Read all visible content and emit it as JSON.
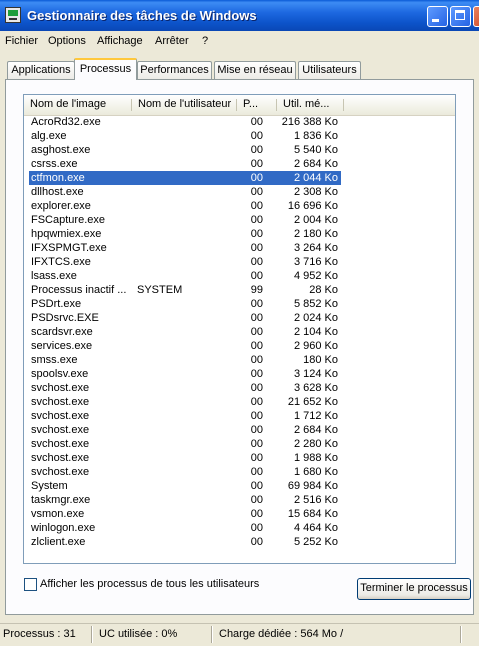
{
  "window": {
    "title": "Gestionnaire des tâches de Windows"
  },
  "menu": [
    "Fichier",
    "Options",
    "Affichage",
    "Arrêter",
    "?"
  ],
  "tabs": [
    {
      "label": "Applications",
      "active": false
    },
    {
      "label": "Processus",
      "active": true
    },
    {
      "label": "Performances",
      "active": false
    },
    {
      "label": "Mise en réseau",
      "active": false
    },
    {
      "label": "Utilisateurs",
      "active": false
    }
  ],
  "table": {
    "columns": [
      "Nom de l'image",
      "Nom de l'utilisateur",
      "P...",
      "Util. mé..."
    ],
    "rows": [
      {
        "name": "AcroRd32.exe",
        "user": "",
        "cpu": "00",
        "mem": "216 388 Ko"
      },
      {
        "name": "alg.exe",
        "user": "",
        "cpu": "00",
        "mem": "1 836 Ko"
      },
      {
        "name": "asghost.exe",
        "user": "",
        "cpu": "00",
        "mem": "5 540 Ko"
      },
      {
        "name": "csrss.exe",
        "user": "",
        "cpu": "00",
        "mem": "2 684 Ko"
      },
      {
        "name": "ctfmon.exe",
        "user": "",
        "cpu": "00",
        "mem": "2 044 Ko",
        "selected": true
      },
      {
        "name": "dllhost.exe",
        "user": "",
        "cpu": "00",
        "mem": "2 308 Ko"
      },
      {
        "name": "explorer.exe",
        "user": "",
        "cpu": "00",
        "mem": "16 696 Ko"
      },
      {
        "name": "FSCapture.exe",
        "user": "",
        "cpu": "00",
        "mem": "2 004 Ko"
      },
      {
        "name": "hpqwmiex.exe",
        "user": "",
        "cpu": "00",
        "mem": "2 180 Ko"
      },
      {
        "name": "IFXSPMGT.exe",
        "user": "",
        "cpu": "00",
        "mem": "3 264 Ko"
      },
      {
        "name": "IFXTCS.exe",
        "user": "",
        "cpu": "00",
        "mem": "3 716 Ko"
      },
      {
        "name": "lsass.exe",
        "user": "",
        "cpu": "00",
        "mem": "4 952 Ko"
      },
      {
        "name": "Processus inactif ...",
        "user": "SYSTEM",
        "cpu": "99",
        "mem": "28 Ko"
      },
      {
        "name": "PSDrt.exe",
        "user": "",
        "cpu": "00",
        "mem": "5 852 Ko"
      },
      {
        "name": "PSDsrvc.EXE",
        "user": "",
        "cpu": "00",
        "mem": "2 024 Ko"
      },
      {
        "name": "scardsvr.exe",
        "user": "",
        "cpu": "00",
        "mem": "2 104 Ko"
      },
      {
        "name": "services.exe",
        "user": "",
        "cpu": "00",
        "mem": "2 960 Ko"
      },
      {
        "name": "smss.exe",
        "user": "",
        "cpu": "00",
        "mem": "180 Ko"
      },
      {
        "name": "spoolsv.exe",
        "user": "",
        "cpu": "00",
        "mem": "3 124 Ko"
      },
      {
        "name": "svchost.exe",
        "user": "",
        "cpu": "00",
        "mem": "3 628 Ko"
      },
      {
        "name": "svchost.exe",
        "user": "",
        "cpu": "00",
        "mem": "21 652 Ko"
      },
      {
        "name": "svchost.exe",
        "user": "",
        "cpu": "00",
        "mem": "1 712 Ko"
      },
      {
        "name": "svchost.exe",
        "user": "",
        "cpu": "00",
        "mem": "2 684 Ko"
      },
      {
        "name": "svchost.exe",
        "user": "",
        "cpu": "00",
        "mem": "2 280 Ko"
      },
      {
        "name": "svchost.exe",
        "user": "",
        "cpu": "00",
        "mem": "1 988 Ko"
      },
      {
        "name": "svchost.exe",
        "user": "",
        "cpu": "00",
        "mem": "1 680 Ko"
      },
      {
        "name": "System",
        "user": "",
        "cpu": "00",
        "mem": "69 984 Ko"
      },
      {
        "name": "taskmgr.exe",
        "user": "",
        "cpu": "00",
        "mem": "2 516 Ko"
      },
      {
        "name": "vsmon.exe",
        "user": "",
        "cpu": "00",
        "mem": "15 684 Ko"
      },
      {
        "name": "winlogon.exe",
        "user": "",
        "cpu": "00",
        "mem": "4 464 Ko"
      },
      {
        "name": "zlclient.exe",
        "user": "",
        "cpu": "00",
        "mem": "5 252 Ko"
      }
    ]
  },
  "show_all_users": {
    "label": "Afficher les processus de tous les utilisateurs",
    "checked": false
  },
  "end_process_button": "Terminer le processus",
  "status": {
    "processes": "Processus : 31",
    "cpu": "UC utilisée : 0%",
    "commit": "Charge dédiée : 564 Mo /"
  },
  "colors": {
    "selection": "#316ac5",
    "titlebar": "#0c53c9",
    "tab_highlight": "#ffc83c"
  }
}
